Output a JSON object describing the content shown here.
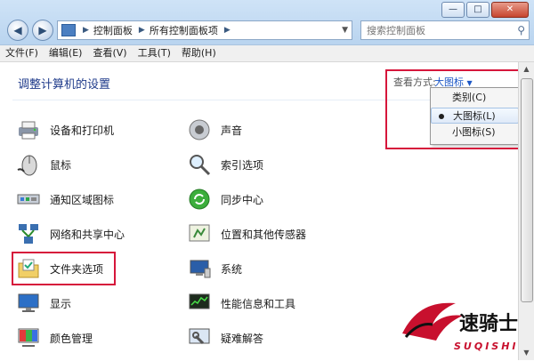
{
  "window": {
    "controls": {
      "minimize": "—",
      "maximize": "□",
      "close": "✕"
    }
  },
  "nav": {
    "back": "◀",
    "forward": "▶",
    "dropdown": "▼"
  },
  "address": {
    "crumbs": [
      "控制面板",
      "所有控制面板项"
    ],
    "sep": "▶",
    "dropdown": "▼"
  },
  "refresh": "↻",
  "search": {
    "placeholder": "搜索控制面板",
    "icon": "search-icon"
  },
  "menu": [
    "文件(F)",
    "编辑(E)",
    "查看(V)",
    "工具(T)",
    "帮助(H)"
  ],
  "header": {
    "title": "调整计算机的设置",
    "view_label": "查看方式:",
    "view_value": "大图标",
    "caret": "▼"
  },
  "view_menu": {
    "options": [
      "类别(C)",
      "大图标(L)",
      "小图标(S)"
    ],
    "selected": "大图标(L)"
  },
  "items": [
    {
      "label": "设备和打印机",
      "icon": "printer-icon"
    },
    {
      "label": "声音",
      "icon": "speaker-icon"
    },
    {
      "label": "鼠标",
      "icon": "mouse-icon"
    },
    {
      "label": "索引选项",
      "icon": "index-search-icon"
    },
    {
      "label": "通知区域图标",
      "icon": "notification-area-icon"
    },
    {
      "label": "同步中心",
      "icon": "sync-center-icon"
    },
    {
      "label": "网络和共享中心",
      "icon": "network-icon"
    },
    {
      "label": "位置和其他传感器",
      "icon": "sensor-icon"
    },
    {
      "label": "文件夹选项",
      "icon": "folder-options-icon"
    },
    {
      "label": "系统",
      "icon": "system-icon"
    },
    {
      "label": "显示",
      "icon": "display-icon"
    },
    {
      "label": "性能信息和工具",
      "icon": "performance-icon"
    },
    {
      "label": "颜色管理",
      "icon": "color-management-icon"
    },
    {
      "label": "疑难解答",
      "icon": "troubleshooting-icon"
    }
  ],
  "scrollbar": {
    "up": "▲",
    "down": "▼"
  },
  "watermark": {
    "text": "速骑士",
    "sub": "SUQISHI"
  },
  "colors": {
    "highlight": "#d6163b",
    "title": "#1e3a8a",
    "link": "#1c57c6"
  }
}
